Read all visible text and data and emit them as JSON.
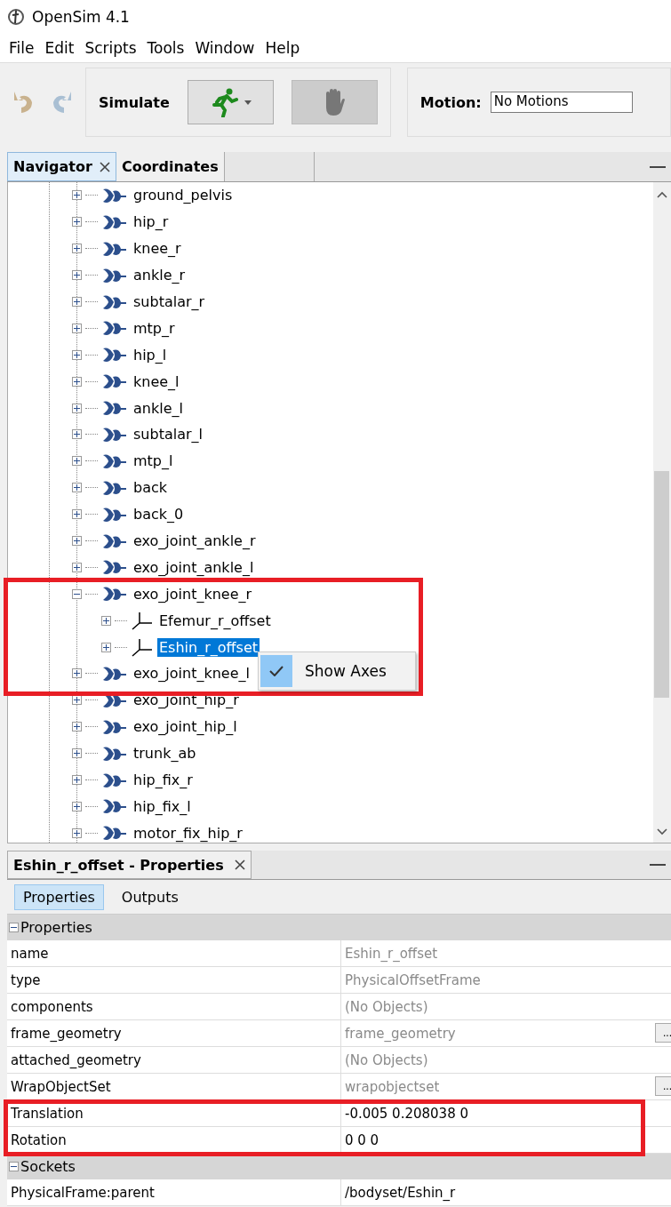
{
  "window": {
    "title": "OpenSim 4.1"
  },
  "menu": [
    "File",
    "Edit",
    "Scripts",
    "Tools",
    "Window",
    "Help"
  ],
  "toolbar": {
    "simulate_label": "Simulate",
    "motion_label": "Motion:",
    "motion_value": "No Motions",
    "stop_disabled": true
  },
  "navigator": {
    "tabs": [
      {
        "label": "Navigator",
        "selected": true,
        "closable": true
      },
      {
        "label": "Coordinates",
        "selected": false,
        "closable": false
      }
    ],
    "items": [
      {
        "label": "ground_pelvis",
        "kind": "joint",
        "expanded": false,
        "selected": false
      },
      {
        "label": "hip_r",
        "kind": "joint",
        "expanded": false,
        "selected": false
      },
      {
        "label": "knee_r",
        "kind": "joint",
        "expanded": false,
        "selected": false
      },
      {
        "label": "ankle_r",
        "kind": "joint",
        "expanded": false,
        "selected": false
      },
      {
        "label": "subtalar_r",
        "kind": "joint",
        "expanded": false,
        "selected": false
      },
      {
        "label": "mtp_r",
        "kind": "joint",
        "expanded": false,
        "selected": false
      },
      {
        "label": "hip_l",
        "kind": "joint",
        "expanded": false,
        "selected": false
      },
      {
        "label": "knee_l",
        "kind": "joint",
        "expanded": false,
        "selected": false
      },
      {
        "label": "ankle_l",
        "kind": "joint",
        "expanded": false,
        "selected": false
      },
      {
        "label": "subtalar_l",
        "kind": "joint",
        "expanded": false,
        "selected": false
      },
      {
        "label": "mtp_l",
        "kind": "joint",
        "expanded": false,
        "selected": false
      },
      {
        "label": "back",
        "kind": "joint",
        "expanded": false,
        "selected": false
      },
      {
        "label": "back_0",
        "kind": "joint",
        "expanded": false,
        "selected": false
      },
      {
        "label": "exo_joint_ankle_r",
        "kind": "joint",
        "expanded": false,
        "selected": false
      },
      {
        "label": "exo_joint_ankle_l",
        "kind": "joint",
        "expanded": false,
        "selected": false
      },
      {
        "label": "exo_joint_knee_r",
        "kind": "joint",
        "expanded": true,
        "selected": false,
        "children": [
          {
            "label": "Efemur_r_offset",
            "kind": "frame",
            "expanded": false,
            "selected": false
          },
          {
            "label": "Eshin_r_offset",
            "kind": "frame",
            "expanded": false,
            "selected": true
          }
        ]
      },
      {
        "label": "exo_joint_knee_l",
        "kind": "joint",
        "expanded": false,
        "selected": false
      },
      {
        "label": "exo_joint_hip_r",
        "kind": "joint",
        "expanded": false,
        "selected": false
      },
      {
        "label": "exo_joint_hip_l",
        "kind": "joint",
        "expanded": false,
        "selected": false
      },
      {
        "label": "trunk_ab",
        "kind": "joint",
        "expanded": false,
        "selected": false
      },
      {
        "label": "hip_fix_r",
        "kind": "joint",
        "expanded": false,
        "selected": false
      },
      {
        "label": "hip_fix_l",
        "kind": "joint",
        "expanded": false,
        "selected": false
      },
      {
        "label": "motor_fix_hip_r",
        "kind": "joint",
        "expanded": false,
        "selected": false
      }
    ]
  },
  "context_menu": {
    "items": [
      {
        "label": "Show Axes",
        "checked": true
      }
    ]
  },
  "properties": {
    "title": "Eshin_r_offset - Properties",
    "tabs": [
      {
        "label": "Properties",
        "selected": true
      },
      {
        "label": "Outputs",
        "selected": false
      }
    ],
    "sections": [
      {
        "title": "Properties",
        "expanded": true,
        "rows": [
          {
            "name": "name",
            "value": "Eshin_r_offset",
            "editable": false
          },
          {
            "name": "type",
            "value": "PhysicalOffsetFrame",
            "editable": false
          },
          {
            "name": "components",
            "value": "(No Objects)",
            "editable": false
          },
          {
            "name": "frame_geometry",
            "value": "frame_geometry",
            "editable": false,
            "button": "..."
          },
          {
            "name": "attached_geometry",
            "value": "(No Objects)",
            "editable": false
          },
          {
            "name": "WrapObjectSet",
            "value": "wrapobjectset",
            "editable": false,
            "button": "..."
          },
          {
            "name": "Translation",
            "value": "-0.005 0.208038 0",
            "editable": true
          },
          {
            "name": "Rotation",
            "value": "0 0 0",
            "editable": true
          }
        ]
      },
      {
        "title": "Sockets",
        "expanded": true,
        "rows": [
          {
            "name": "PhysicalFrame:parent",
            "value": "/bodyset/Eshin_r",
            "editable": true
          }
        ]
      }
    ]
  }
}
